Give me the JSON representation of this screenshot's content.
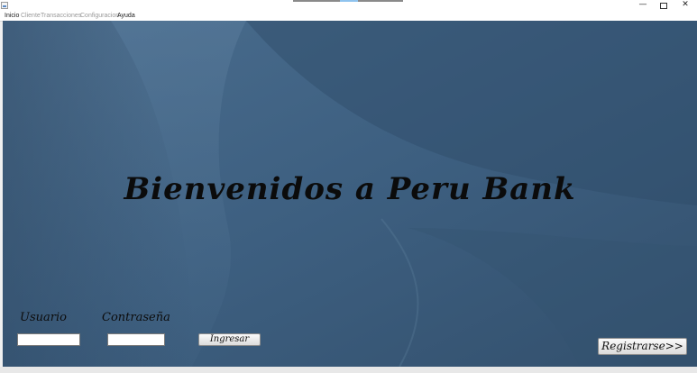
{
  "window": {
    "minimize_glyph": "—",
    "close_glyph": "✕"
  },
  "menu": {
    "items": [
      {
        "label": "Inicio",
        "enabled": true
      },
      {
        "label": "Cliente",
        "enabled": false
      },
      {
        "label": "Transacciones",
        "enabled": false
      },
      {
        "label": "Configuracion",
        "enabled": false
      },
      {
        "label": "Ayuda",
        "enabled": true
      }
    ]
  },
  "main": {
    "welcome_text": "Bienvenidos a Peru Bank"
  },
  "login": {
    "user_label": "Usuario",
    "user_value": "",
    "password_label": "Contraseña",
    "password_value": "",
    "submit_label": "Ingresar"
  },
  "register": {
    "label": "Registrarse>>"
  },
  "colors": {
    "background_base": "#3d5d7e",
    "background_light": "#4f7293",
    "background_dark": "#2f4b68"
  }
}
